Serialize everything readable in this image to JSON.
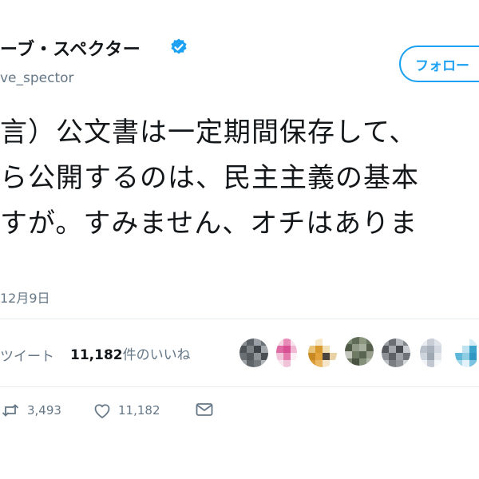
{
  "profile": {
    "display_name": "ーブ・スペクター",
    "handle": "ve_spector",
    "verified_icon": "verified-badge-icon"
  },
  "follow_button": {
    "label": "フォロー"
  },
  "tweet": {
    "lines": [
      "言）公文書は一定期間保存して、",
      "ら公開するのは、民主主義の基本",
      "すが。すみません、オチはありま"
    ]
  },
  "meta": {
    "date": "12月9日"
  },
  "stats": {
    "retweets_label": "ツイート",
    "likes_count": "11,182",
    "likes_label": "件のいいね"
  },
  "actions": {
    "retweet_count": "3,493",
    "like_count": "11,182"
  },
  "colors": {
    "accent": "#1da1f2",
    "muted": "#657786",
    "text": "#14171a",
    "divider": "#e6ecf0"
  }
}
